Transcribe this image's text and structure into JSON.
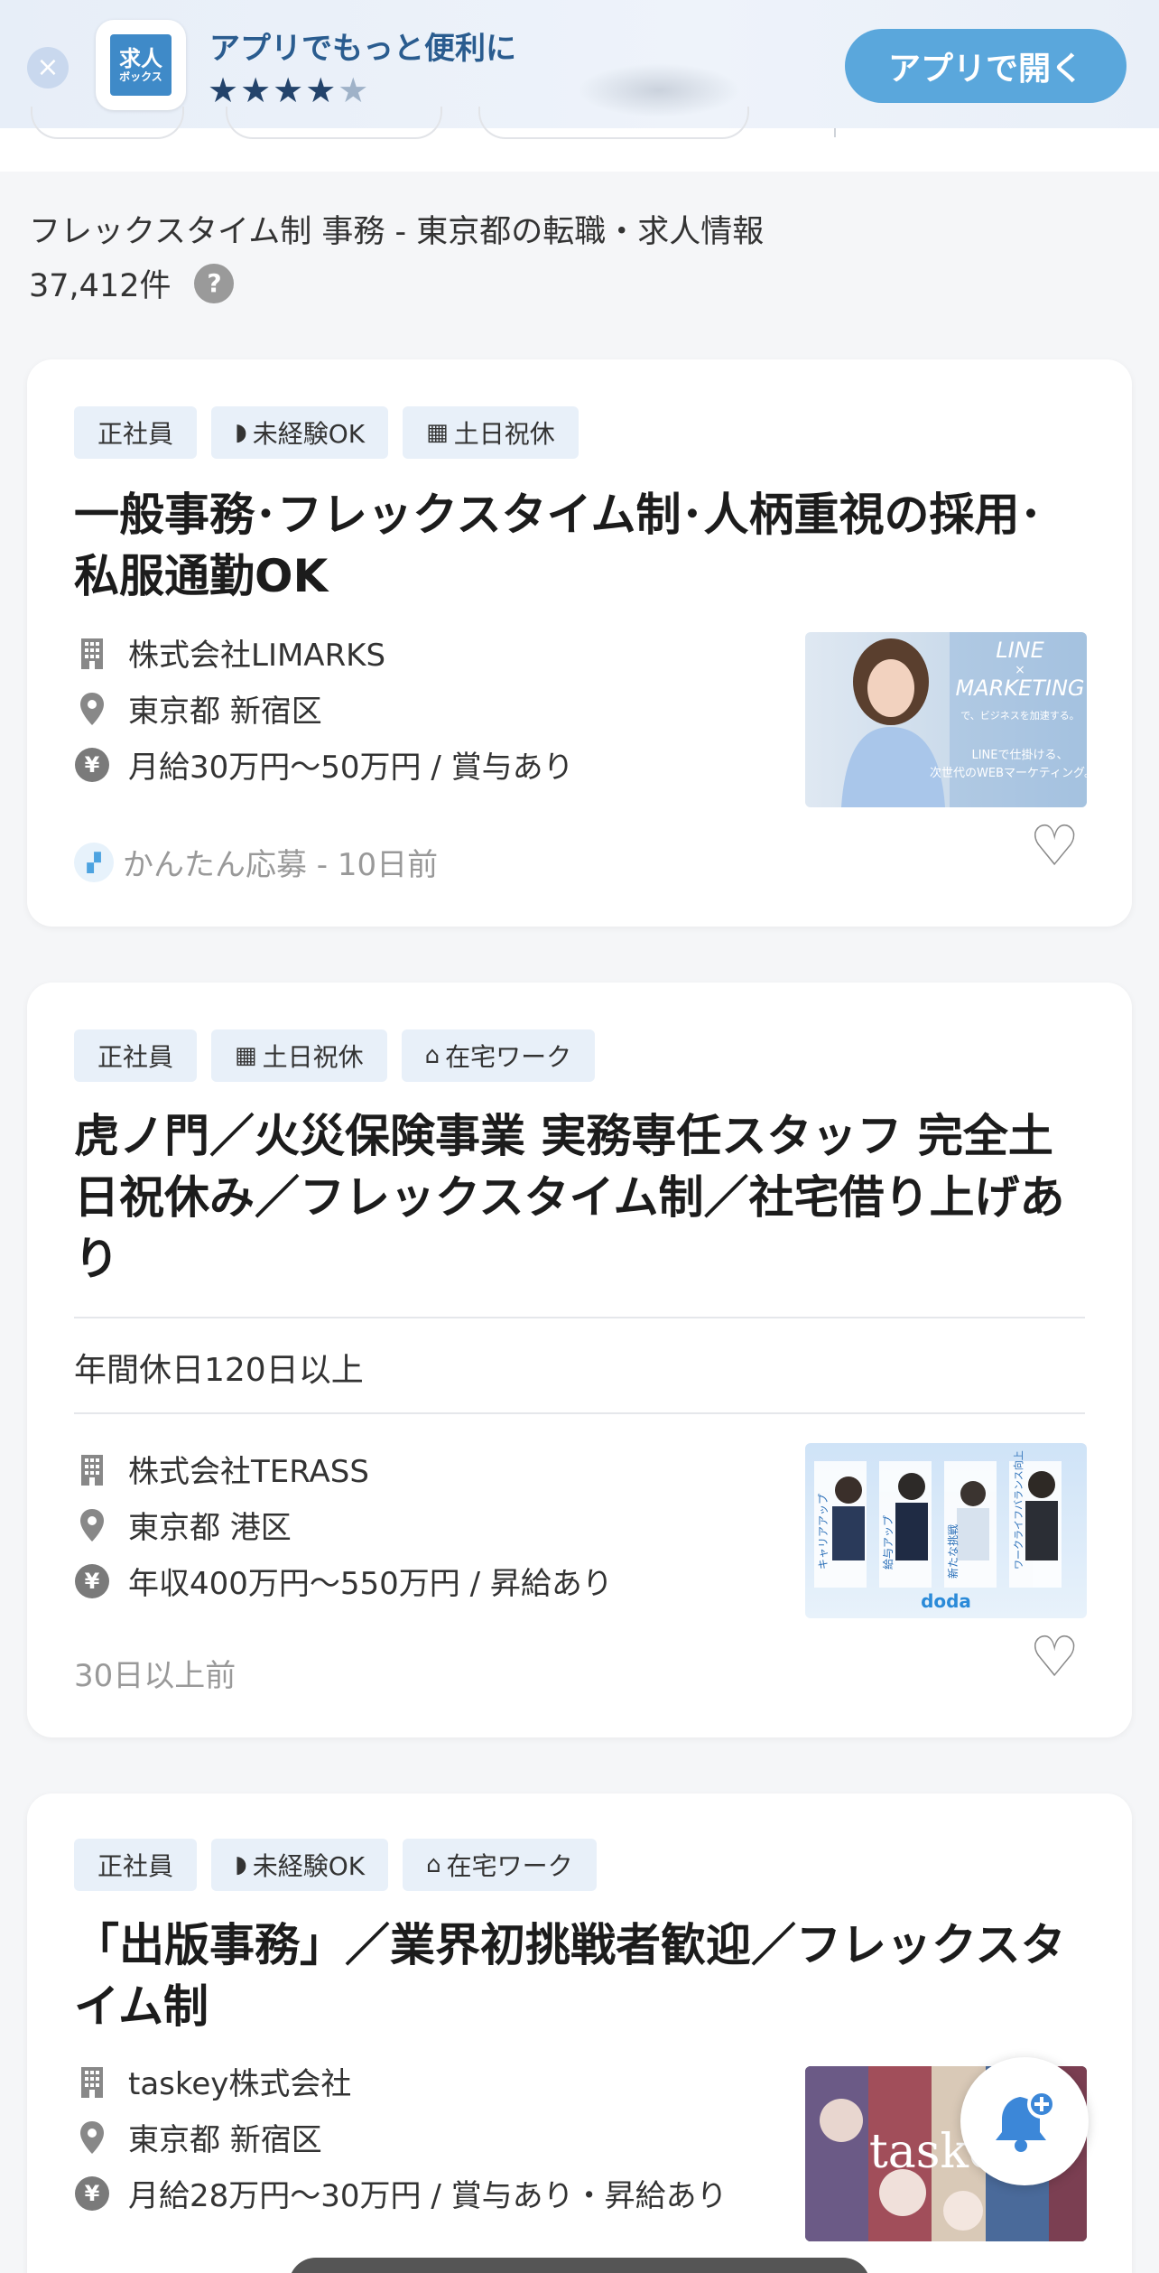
{
  "banner": {
    "close_label": "×",
    "logo_line1": "求人",
    "logo_line2": "ボックス",
    "title": "アプリでもっと便利に",
    "stars": "★★★★",
    "half_star": "★",
    "open_button": "アプリで開く"
  },
  "results": {
    "title": "フレックスタイム制 事務 - 東京都の転職・求人情報",
    "count": "37,412件",
    "help": "?"
  },
  "jobs": [
    {
      "tags": [
        "正社員",
        "未経験OK",
        "土日祝休"
      ],
      "title": "一般事務･フレックスタイム制･人柄重視の採用･私服通勤OK",
      "company": "株式会社LIMARKS",
      "location": "東京都 新宿区",
      "salary": "月給30万円〜50万円 / 賞与あり",
      "footer": "かんたん応募 - 10日前",
      "thumb_text": [
        "LINE",
        "×",
        "MARKETING",
        "で、ビジネスを加速する。",
        "LINEで仕掛ける、",
        "次世代のWEBマーケティング。"
      ]
    },
    {
      "tags": [
        "正社員",
        "土日祝休",
        "在宅ワーク"
      ],
      "title": "虎ノ門／火災保険事業 実務専任スタッフ 完全土日祝休み／フレックスタイム制／社宅借り上げあり",
      "highlight": "年間休日120日以上",
      "company": "株式会社TERASS",
      "location": "東京都 港区",
      "salary": "年収400万円〜550万円 / 昇給あり",
      "footer": "30日以上前",
      "thumb_text": [
        "キャリアアップ",
        "給与アップ",
        "新たな挑戦",
        "ワークライフバランス向上",
        "doda"
      ]
    },
    {
      "tags": [
        "正社員",
        "未経験OK",
        "在宅ワーク"
      ],
      "title": "「出版事務」／業界初挑戦者歓迎／フレックスタイム制",
      "company": "taskey株式会社",
      "location": "東京都 新宿区",
      "salary": "月給28万円〜30万円 / 賞与あり・昇給あり",
      "thumb_text": [
        "taskey"
      ]
    }
  ],
  "colors": {
    "accent": "#5aa7dc",
    "tag_bg": "#e8f0f9",
    "bell": "#3c87d8"
  }
}
